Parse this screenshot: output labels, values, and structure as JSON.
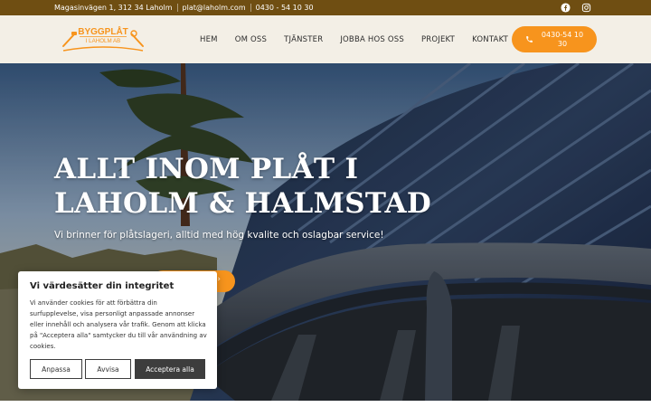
{
  "topbar": {
    "address": "Magasinvägen 1, 312 34 Laholm",
    "email": "plat@laholm.com",
    "phone": "0430 - 54 10 30",
    "social_icons": [
      "facebook-icon",
      "instagram-icon"
    ]
  },
  "header": {
    "logo_line1": "BYGGPLÅT",
    "logo_line2": "I LAHOLM AB",
    "nav": [
      "HEM",
      "OM OSS",
      "TJÄNSTER",
      "JOBBA HOS OSS",
      "PROJEKT",
      "KONTAKT"
    ],
    "call_button": "0430-54 10 30",
    "call_icon": "phone-icon"
  },
  "hero": {
    "title": "ALLT INOM PLÅT I LAHOLM & HALMSTAD",
    "subtitle": "Vi brinner för plåtslageri, alltid med hög kvalite och oslagbar service!"
  },
  "cookie": {
    "title": "Vi värdesätter din integritet",
    "text": "Vi använder cookies för att förbättra din surfupplevelse, visa personligt anpassade annonser eller innehåll och analysera vår trafik. Genom att klicka på \"Acceptera alla\" samtycker du till vår användning av cookies.",
    "customize": "Anpassa",
    "reject": "Avvisa",
    "accept": "Acceptera alla"
  },
  "colors": {
    "topbar": "#6f4e12",
    "header_bg": "#f3efe6",
    "accent": "#f7941d",
    "dark_button": "#3d3d3d"
  }
}
